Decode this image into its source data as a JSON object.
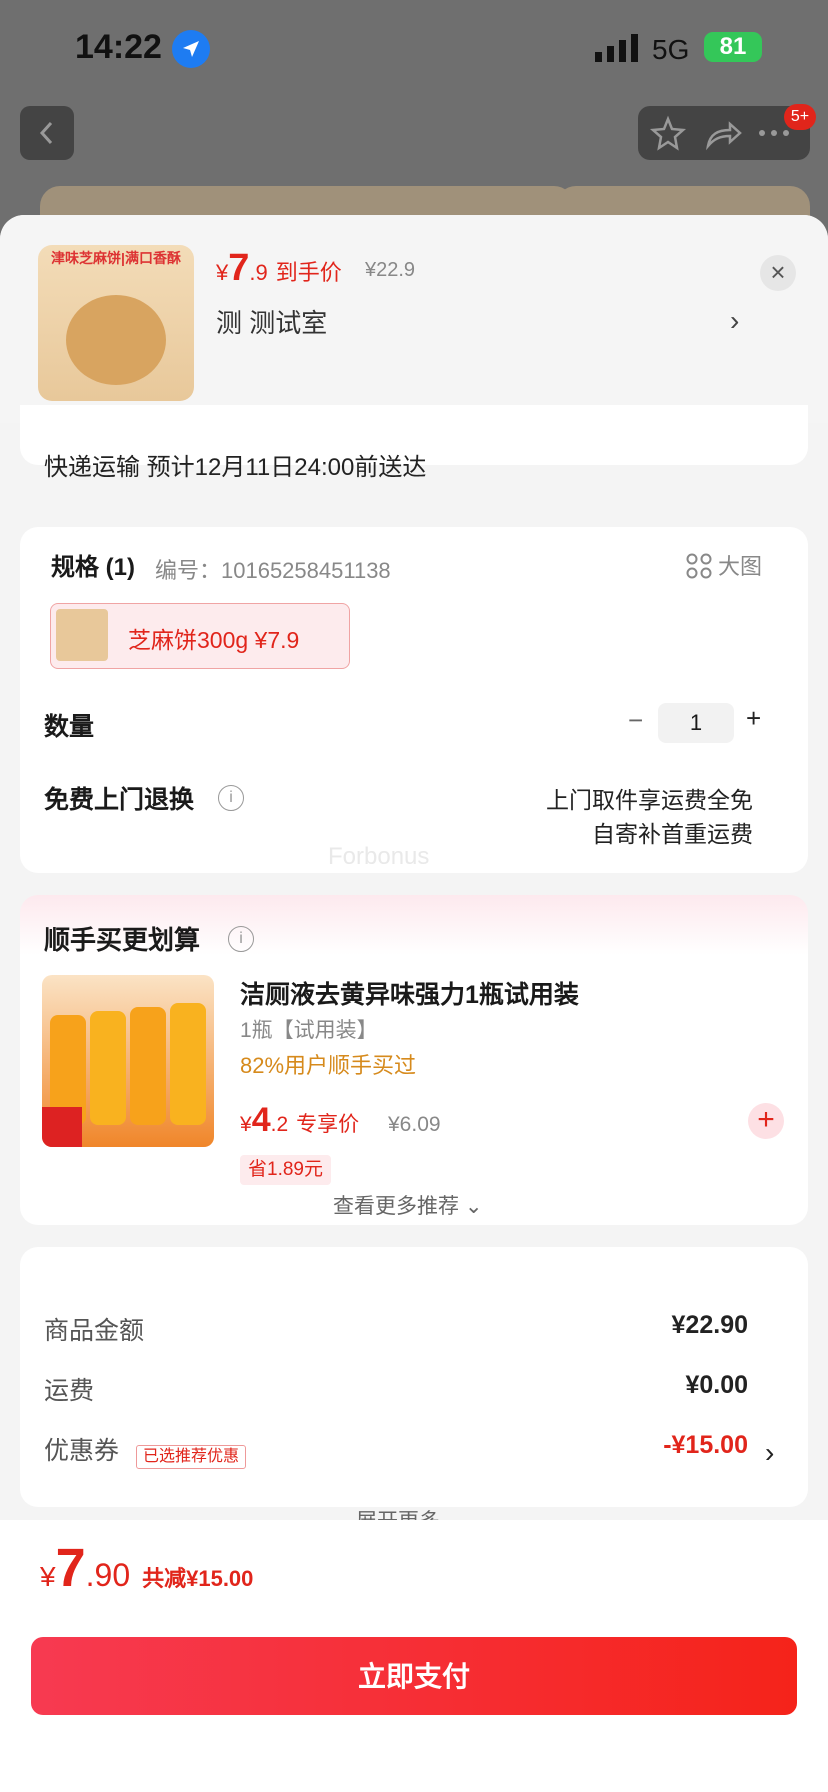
{
  "status_bar": {
    "time": "14:22",
    "network": "5G",
    "battery": "81"
  },
  "nav": {
    "badge": "5+"
  },
  "product": {
    "thumb_label": "津味芝麻饼|满口香酥",
    "currency": "¥",
    "price_int": "7",
    "price_dec": ".9",
    "price_label": "到手价",
    "original_price": "¥22.9",
    "shop_name": "测 测试室"
  },
  "shipping": {
    "text": "快递运输 预计12月11日24:00前送达"
  },
  "spec": {
    "title": "规格 (1)",
    "code": "编号：10165258451138",
    "big_image_label": "大图",
    "selected_option": "芝麻饼300g  ¥7.9"
  },
  "quantity": {
    "label": "数量",
    "minus": "−",
    "value": "1",
    "plus": "+"
  },
  "returns": {
    "label": "免费上门退换",
    "line1": "上门取件享运费全免",
    "line2": "自寄补首重运费"
  },
  "watermark": "Forbonus",
  "bundle": {
    "title": "顺手买更划算",
    "item": {
      "name": "洁厕液去黄异味强力1瓶试用装",
      "sku": "1瓶【试用装】",
      "social_proof": "82%用户顺手买过",
      "currency": "¥",
      "price_int": "4",
      "price_dec": ".2",
      "price_label": "专享价",
      "original_price": "¥6.09",
      "save_tag": "省1.89元",
      "add_symbol": "+"
    },
    "more_label": "查看更多推荐 ⌄"
  },
  "summary": {
    "rows": [
      {
        "label": "商品金额",
        "value": "¥22.90"
      },
      {
        "label": "运费",
        "value": "¥0.00"
      },
      {
        "label": "优惠券",
        "value": "-¥15.00",
        "tag": "已选推荐优惠"
      }
    ],
    "expand_label": "展开更多 ⌄"
  },
  "footer": {
    "currency": "¥",
    "total_int": "7",
    "total_dec": ".90",
    "discount_note": "共减¥15.00",
    "pay_label": "立即支付"
  },
  "colors": {
    "accent": "#e1251b",
    "pay_gradient_start": "#f73a51",
    "pay_gradient_end": "#f5231a"
  }
}
